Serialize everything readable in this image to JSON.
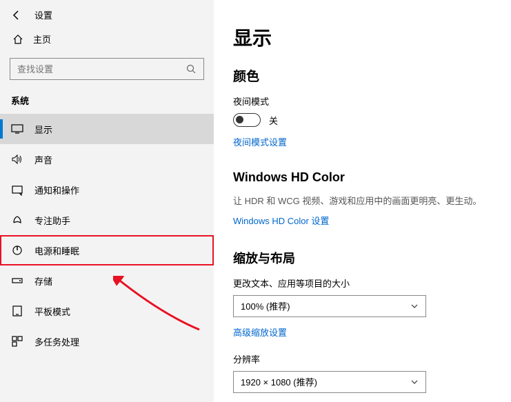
{
  "header": {
    "app_title": "设置"
  },
  "home": {
    "label": "主页"
  },
  "search": {
    "placeholder": "查找设置"
  },
  "category": {
    "label": "系统"
  },
  "nav": {
    "items": [
      {
        "label": "显示"
      },
      {
        "label": "声音"
      },
      {
        "label": "通知和操作"
      },
      {
        "label": "专注助手"
      },
      {
        "label": "电源和睡眠"
      },
      {
        "label": "存储"
      },
      {
        "label": "平板模式"
      },
      {
        "label": "多任务处理"
      }
    ]
  },
  "main": {
    "title": "显示",
    "color_heading": "颜色",
    "night_label": "夜间模式",
    "night_state": "关",
    "night_link": "夜间模式设置",
    "hdcolor_heading": "Windows HD Color",
    "hdcolor_desc": "让 HDR 和 WCG 视频、游戏和应用中的画面更明亮、更生动。",
    "hdcolor_link": "Windows HD Color 设置",
    "scale_heading": "缩放与布局",
    "scale_label": "更改文本、应用等项目的大小",
    "scale_value": "100% (推荐)",
    "scale_link": "高级缩放设置",
    "res_label": "分辨率",
    "res_value": "1920 × 1080 (推荐)"
  }
}
